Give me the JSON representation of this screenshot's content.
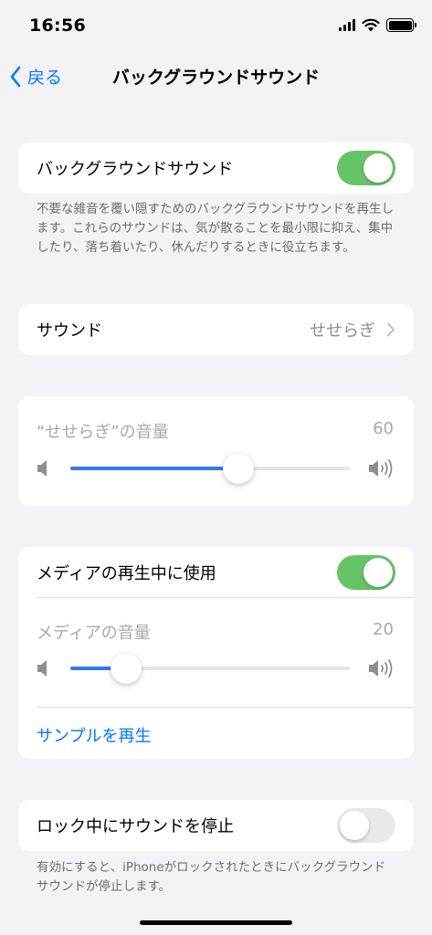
{
  "status": {
    "time": "16:56"
  },
  "nav": {
    "back_label": "戻る",
    "title": "バックグラウンドサウンド"
  },
  "background_sound": {
    "label": "バックグラウンドサウンド",
    "enabled": true,
    "description": "不要な雑音を覆い隠すためのバックグラウンドサウンドを再生します。これらのサウンドは、気が散ることを最小限に抑え、集中したり、落ち着いたり、休んだりするときに役立ちます。"
  },
  "sound": {
    "label": "サウンド",
    "value": "せせらぎ"
  },
  "sound_volume": {
    "label": "“せせらぎ”の音量",
    "value": "60",
    "level": 60
  },
  "media": {
    "label": "メディアの再生中に使用",
    "enabled": true,
    "volume_label": "メディアの音量",
    "volume_value": "20",
    "volume_level": 20,
    "sample_label": "サンプルを再生"
  },
  "lock": {
    "label": "ロック中にサウンドを停止",
    "enabled": false,
    "description": "有効にすると、iPhoneがロックされたときにバックグラウンドサウンドが停止します。"
  },
  "colors": {
    "accent": "#007aff",
    "toggle_on": "#65c466",
    "slider_fill": "#3478f6"
  },
  "icons": [
    "chevron-left-icon",
    "chevron-right-icon",
    "speaker-low-icon",
    "speaker-high-icon",
    "signal-icon",
    "wifi-icon",
    "battery-icon"
  ]
}
